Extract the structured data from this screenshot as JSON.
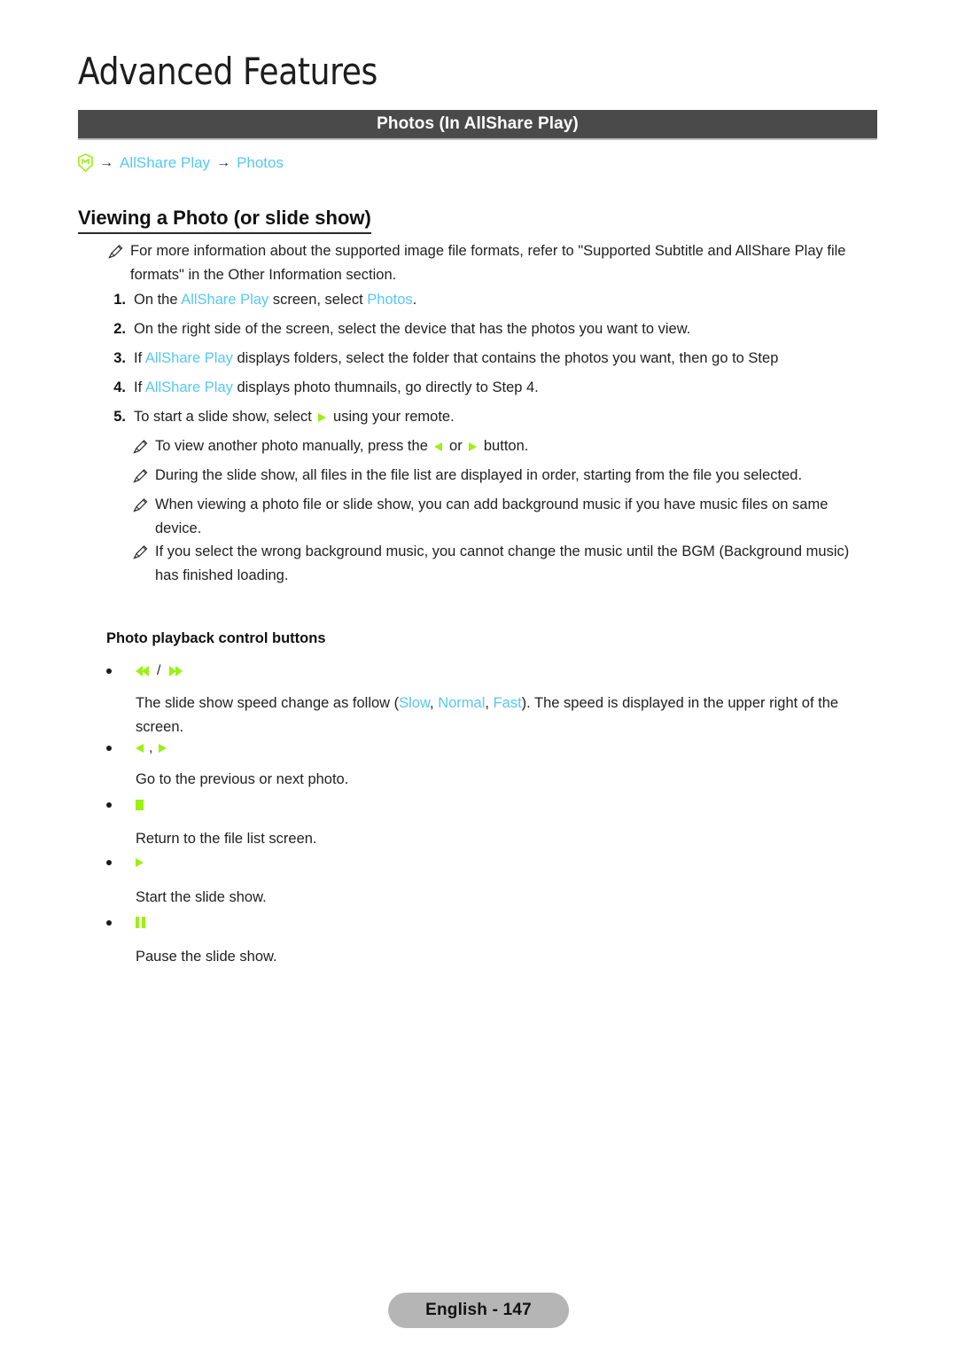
{
  "document": {
    "chapter_title": "Advanced Features",
    "section_bar_label": "Photos (In AllShare Play)"
  },
  "colors": {
    "accent_link": "#55c8f5",
    "remote_green": "#9cf011",
    "section_bar_bg": "#4a4a4a",
    "footer_pill_bg": "#b5b5b5"
  },
  "breadcrumb": {
    "menu_icon": "menu-icon",
    "arrow1": "→",
    "item1": "AllShare Play",
    "arrow2": "→",
    "item2": "Photos"
  },
  "content": {
    "sub_heading": "Viewing a Photo (or slide show)",
    "intro_note": {
      "icon": "pencil-note-icon",
      "text_part1": "For more information about the supported image file formats, refer to \"Supported Subtitle and  AllShare Play file formats\" in the Other Information section."
    },
    "steps": [
      {
        "num": "1.",
        "pre": "On the ",
        "link1": "AllShare Play",
        "mid": " screen, select ",
        "link2": "Photos",
        "post": "."
      },
      {
        "num": "2.",
        "pre": "On the right side of the screen, select the device that has the photos you want to view.",
        "link1": "",
        "mid": "",
        "link2": "",
        "post": ""
      },
      {
        "num": "3.",
        "pre": "If ",
        "link1": "AllShare Play",
        "mid": " displays folders, select the folder that contains the photos you want, then go to Step",
        "link2": "",
        "post": ""
      },
      {
        "num": "4.",
        "pre": "If ",
        "link1": "AllShare Play",
        "mid": " displays photo thumnails, go directly to Step 4.",
        "link2": "",
        "post": ""
      },
      {
        "num": "5.",
        "pre": "To start a slide show, select ",
        "link1": "",
        "mid": "",
        "link2": "",
        "post": " using your remote.",
        "glyph": "play-icon"
      }
    ],
    "notes": [
      {
        "icon": "pencil-note-icon",
        "pre": "To view another photo manually, press the ",
        "mid": " or ",
        "post": " button.",
        "glyph_left": "previous-icon",
        "glyph_right": "next-icon"
      },
      {
        "icon": "pencil-note-icon",
        "text": "During the slide show, all files in the file list are displayed in order, starting from the file you selected."
      },
      {
        "icon": "pencil-note-icon",
        "text": "When viewing a photo file or slide show, you can add background music if you have music files on same device."
      },
      {
        "icon": "pencil-note-icon",
        "text": "If you select the wrong background music, you cannot change the music until the BGM (Background music) has finished loading."
      }
    ],
    "controls": {
      "title": "Photo playback control buttons",
      "items": [
        {
          "glyph": "rewind-forward-icons",
          "separator": "/",
          "desc_pre": "The slide show speed change as follow (",
          "opt1": "Slow",
          "sep1": ", ",
          "opt2": "Normal",
          "sep2": ", ",
          "opt3": "Fast",
          "desc_post": "). The speed is displayed in the upper right of the screen."
        },
        {
          "glyph": "previous-next-icons",
          "separator": ",",
          "desc": "Go to the previous or next photo."
        },
        {
          "glyph": "stop-icon",
          "desc": "Return to the file list screen."
        },
        {
          "glyph": "play-icon",
          "desc": "Start the slide show."
        },
        {
          "glyph": "pause-icon",
          "desc": "Pause the slide show."
        }
      ]
    }
  },
  "footer": {
    "page_label": "English - 147"
  }
}
